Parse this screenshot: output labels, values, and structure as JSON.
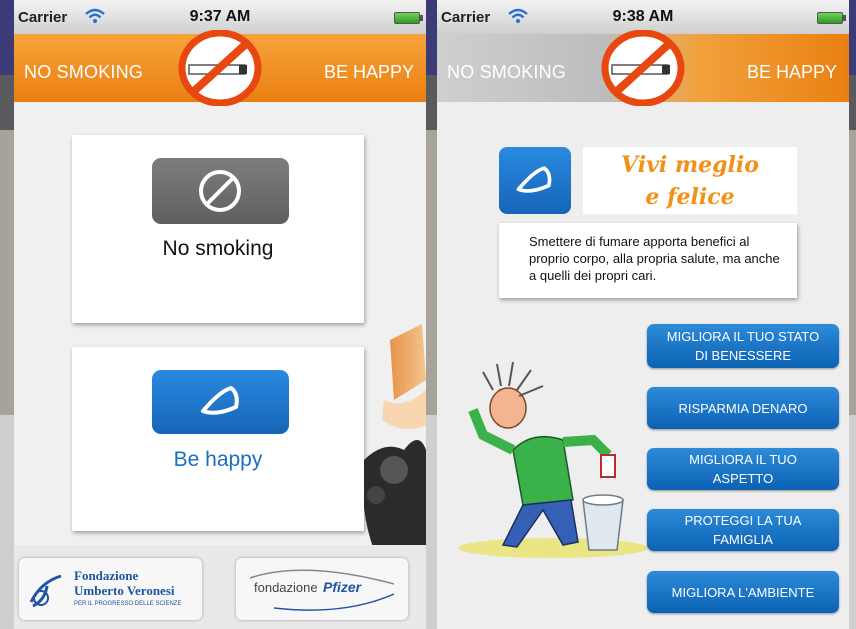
{
  "status_left": {
    "carrier": "Carrier",
    "time": "9:37 AM"
  },
  "status_right": {
    "carrier": "Carrier",
    "time": "9:38 AM"
  },
  "header": {
    "left_text": "NO SMOKING",
    "right_text": "BE HAPPY"
  },
  "screen1": {
    "no_smoking_label": "No smoking",
    "be_happy_label": "Be happy",
    "sponsor_veronesi": {
      "line1": "Fondazione",
      "line2": "Umberto Veronesi",
      "line3": "PER IL PROGRESSO DELLE SCIENZE"
    },
    "sponsor_pfizer": {
      "prefix": "fondazione",
      "brand": "Pfizer"
    }
  },
  "screen2": {
    "banner_line1": "Vivi meglio",
    "banner_line2": "e felice",
    "info_text": "Smettere di fumare apporta benefici al proprio corpo, alla propria salute, ma anche a quelli dei propri cari.",
    "buttons": [
      {
        "line1": "MIGLIORA IL TUO STATO",
        "line2": "DI BENESSERE"
      },
      {
        "line1": "RISPARMIA DENARO",
        "line2": ""
      },
      {
        "line1": "MIGLIORA IL TUO",
        "line2": "ASPETTO"
      },
      {
        "line1": "PROTEGGI LA TUA",
        "line2": "FAMIGLIA"
      },
      {
        "line1": "MIGLIORA L'AMBIENTE",
        "line2": ""
      }
    ]
  },
  "colors": {
    "orange": "#EA8012",
    "blue": "#1565B8",
    "grey_tile": "#707070"
  },
  "icons": [
    "wifi-icon",
    "battery-icon",
    "no-smoking-icon",
    "prohibited-icon",
    "smile-icon"
  ]
}
